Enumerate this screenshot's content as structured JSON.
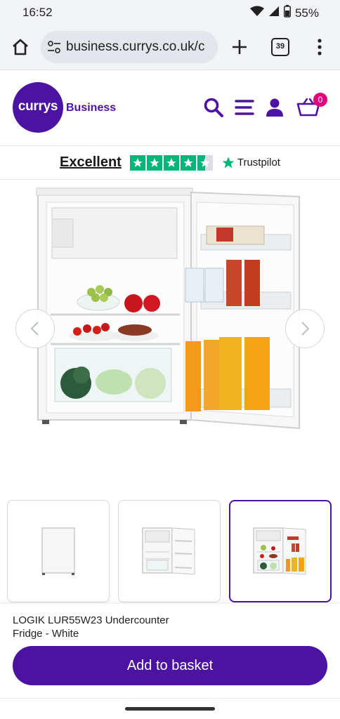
{
  "status": {
    "time": "16:52",
    "battery": "55%",
    "icons": [
      "wifi-icon",
      "signal-icon",
      "battery-icon"
    ]
  },
  "browser": {
    "url": "business.currys.co.uk/c",
    "tab_count": "39"
  },
  "header": {
    "logo_word": "currys",
    "logo_sub": "Business",
    "basket_count": "0",
    "brand_color": "#4c12a1",
    "badge_color": "#e5007e"
  },
  "trust": {
    "label": "Excellent",
    "brand": "Trustpilot",
    "star_color": "#00b67a",
    "stars": 4.5
  },
  "product": {
    "name": "LOGIK LUR55W23 Undercounter Fridge - White",
    "thumbnails": [
      "fridge-closed",
      "fridge-open-empty",
      "fridge-open-stocked"
    ],
    "active_thumbnail": 2
  },
  "actions": {
    "add_to_basket": "Add to basket"
  }
}
